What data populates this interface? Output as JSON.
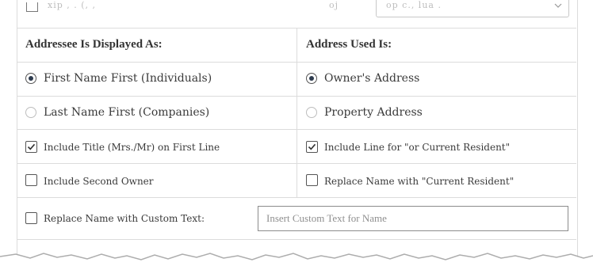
{
  "top_row": {
    "left_text": "xip , . (, ,",
    "mid_text": "oj",
    "select_value": "op c., lua ."
  },
  "addressee": {
    "header": "Addressee Is Displayed As:",
    "options": [
      {
        "label": "First Name First (Individuals)",
        "selected": true
      },
      {
        "label": "Last Name First (Companies)",
        "selected": false
      }
    ],
    "include_title": {
      "label": "Include Title (Mrs./Mr) on First Line",
      "checked": true
    },
    "include_second_owner": {
      "label": "Include Second Owner",
      "checked": false
    }
  },
  "address_used": {
    "header": "Address Used Is:",
    "options": [
      {
        "label": "Owner's Address",
        "selected": true
      },
      {
        "label": "Property Address",
        "selected": false
      }
    ],
    "include_current_resident": {
      "label": "Include Line for \"or Current Resident\"",
      "checked": true
    },
    "replace_current_resident": {
      "label": "Replace Name with \"Current Resident\"",
      "checked": false
    }
  },
  "custom_text": {
    "label": "Replace Name with Custom Text:",
    "checked": false,
    "placeholder": "Insert Custom Text for Name",
    "value": ""
  },
  "colors": {
    "border": "#dcdcdc",
    "radio_selected": "#2e3b4e",
    "text": "#3a3a3a"
  }
}
